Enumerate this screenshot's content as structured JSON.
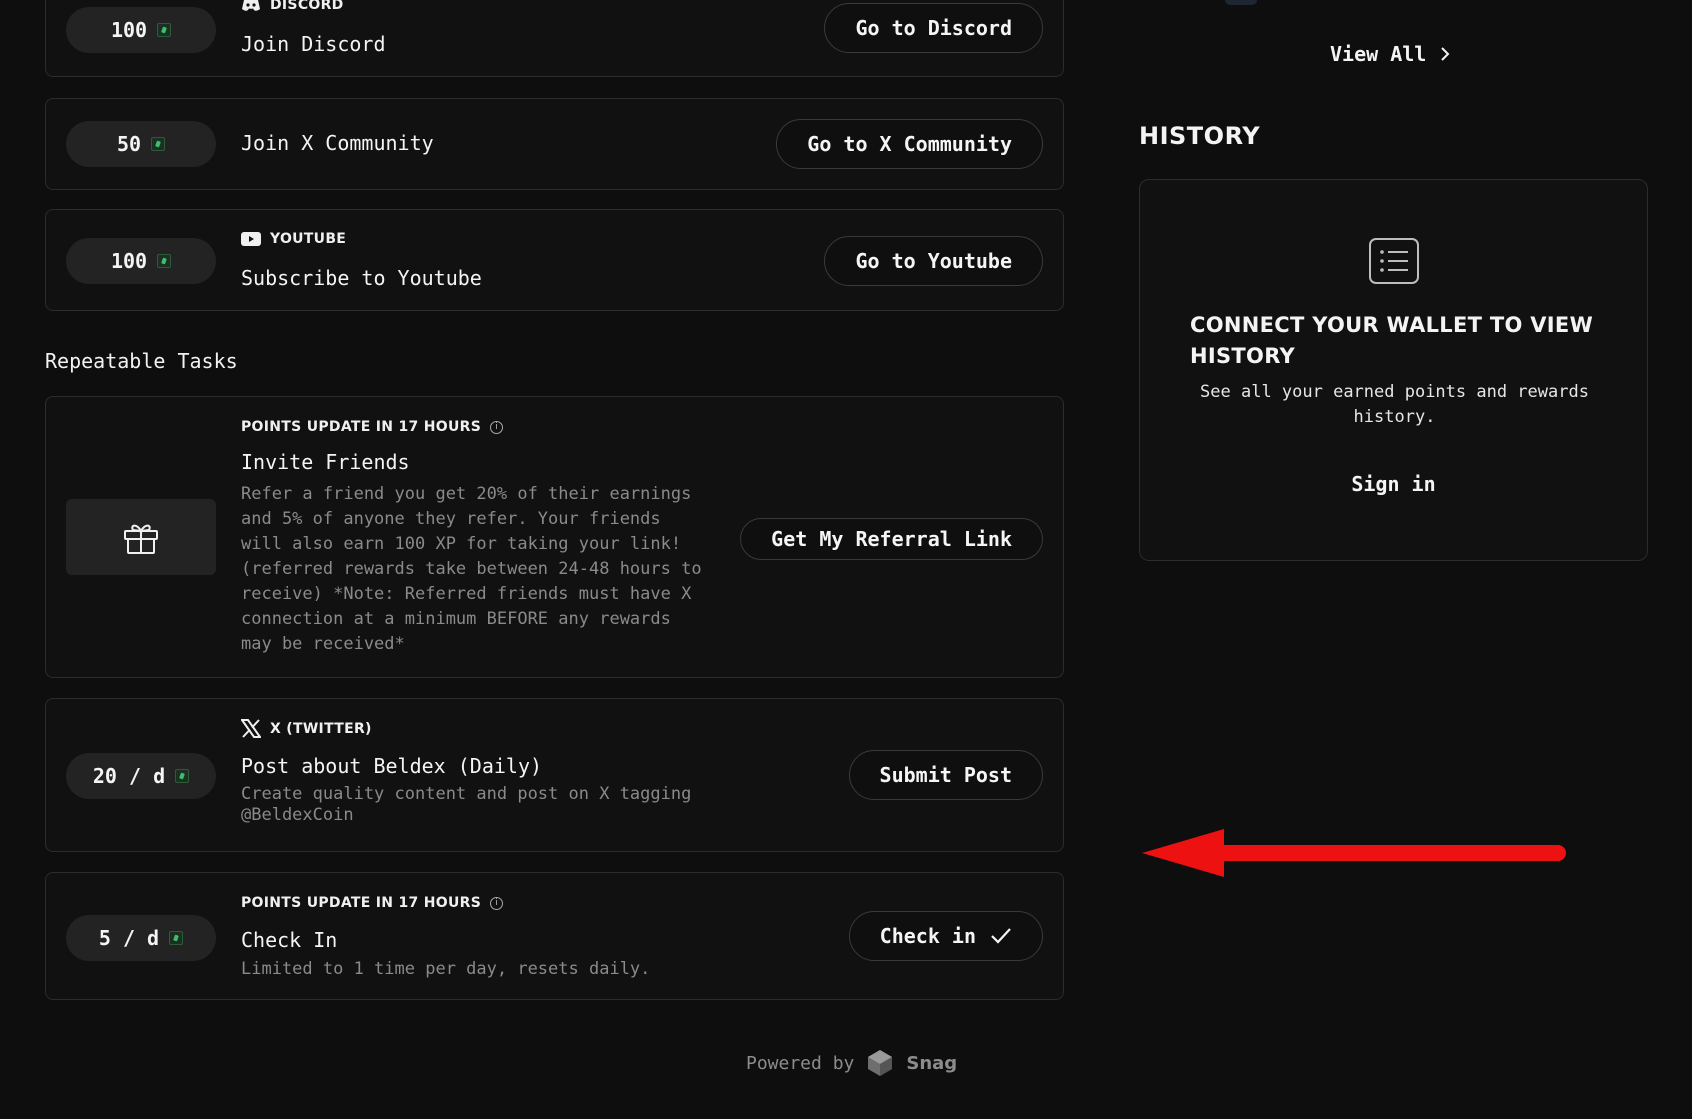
{
  "tasks": {
    "discord": {
      "points": "100",
      "tag": "DISCORD",
      "title": "Join Discord",
      "button": "Go to Discord"
    },
    "x_community": {
      "points": "50",
      "title": "Join X Community",
      "button": "Go to X Community"
    },
    "youtube": {
      "points": "100",
      "tag": "YOUTUBE",
      "title": "Subscribe to Youtube",
      "button": "Go to Youtube"
    }
  },
  "repeatable": {
    "heading": "Repeatable Tasks",
    "invite": {
      "tag": "POINTS UPDATE IN 17 HOURS",
      "title": "Invite Friends",
      "description_lines": [
        "Refer a friend you get 20% of their earnings",
        "and 5% of anyone they refer. Your friends",
        "will also earn 100 XP for taking your link!",
        "(referred rewards take between 24-48 hours to",
        "receive) *Note: Referred friends must have X",
        "connection at a minimum BEFORE any rewards",
        "may be received*"
      ],
      "button": "Get My Referral Link"
    },
    "post": {
      "points": "20 / d",
      "tag": "X (TWITTER)",
      "title": "Post about Beldex (Daily)",
      "description_lines": [
        "Create quality content and post on X tagging",
        "@BeldexCoin"
      ],
      "button": "Submit Post"
    },
    "checkin": {
      "points": "5 / d",
      "tag": "POINTS UPDATE IN 17 HOURS",
      "title": "Check In",
      "description": "Limited to 1 time per day, resets daily.",
      "button": "Check in"
    }
  },
  "sidebar": {
    "view_all": "View All",
    "history_title": "HISTORY",
    "history_heading": "CONNECT YOUR WALLET TO VIEW HISTORY",
    "history_sub": "See all your earned points and rewards history.",
    "sign_in": "Sign in"
  },
  "footer": {
    "powered_by": "Powered by",
    "brand": "Snag"
  },
  "icons": {
    "discord": "discord-icon",
    "youtube": "youtube-icon",
    "x": "x-logo-icon",
    "gift": "gift-icon",
    "info": "info-icon",
    "check": "check-icon",
    "chevron": "chevron-right-icon",
    "list": "list-icon",
    "snag": "snag-logo-icon"
  },
  "colors": {
    "background": "#0e0e0e",
    "card": "#111111",
    "border": "#2c2c2c",
    "muted": "#8a8a8a",
    "annotation": "#ee1111"
  }
}
